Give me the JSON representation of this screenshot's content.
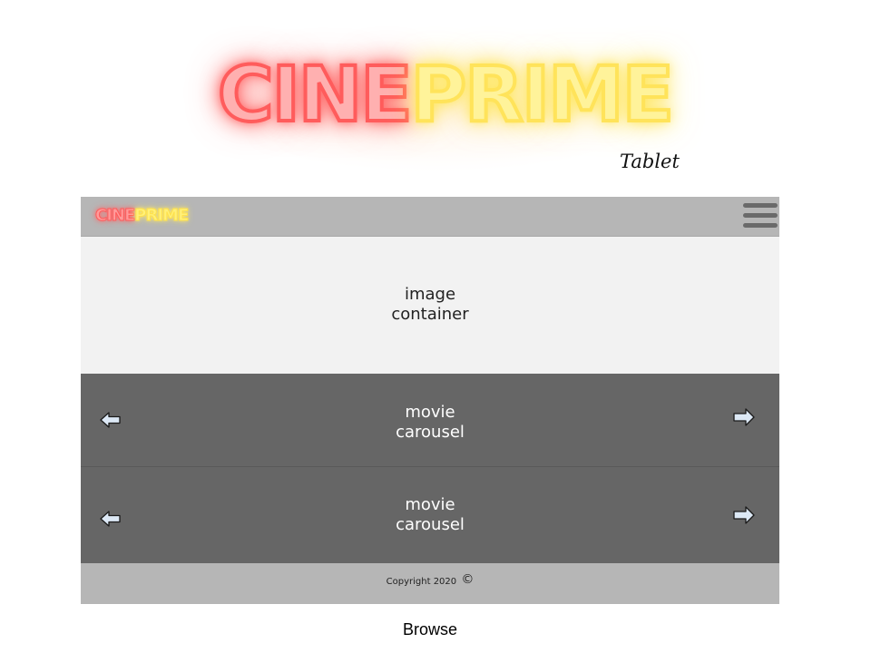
{
  "hero": {
    "logo_part1": "CINE",
    "logo_part2": "PRIME",
    "device_label": "Tablet"
  },
  "nav": {
    "logo_part1": "CINE",
    "logo_part2": "PRIME",
    "menu_icon": "hamburger-menu-icon"
  },
  "image_container": {
    "line1": "image",
    "line2": "container"
  },
  "carousels": [
    {
      "line1": "movie",
      "line2": "carousel",
      "left_icon": "arrow-left-icon",
      "right_icon": "arrow-right-icon"
    },
    {
      "line1": "movie",
      "line2": "carousel",
      "left_icon": "arrow-left-icon",
      "right_icon": "arrow-right-icon"
    }
  ],
  "footer": {
    "copyright": "Copyright 2020",
    "symbol": "©"
  },
  "caption": "Browse",
  "colors": {
    "neon_red": "#ff5c5c",
    "neon_yellow": "#ffe35a",
    "nav_bg": "#b6b6b6",
    "image_bg": "#f2f2f2",
    "carousel_bg": "#666666",
    "arrow_fill": "#dce8f5"
  }
}
